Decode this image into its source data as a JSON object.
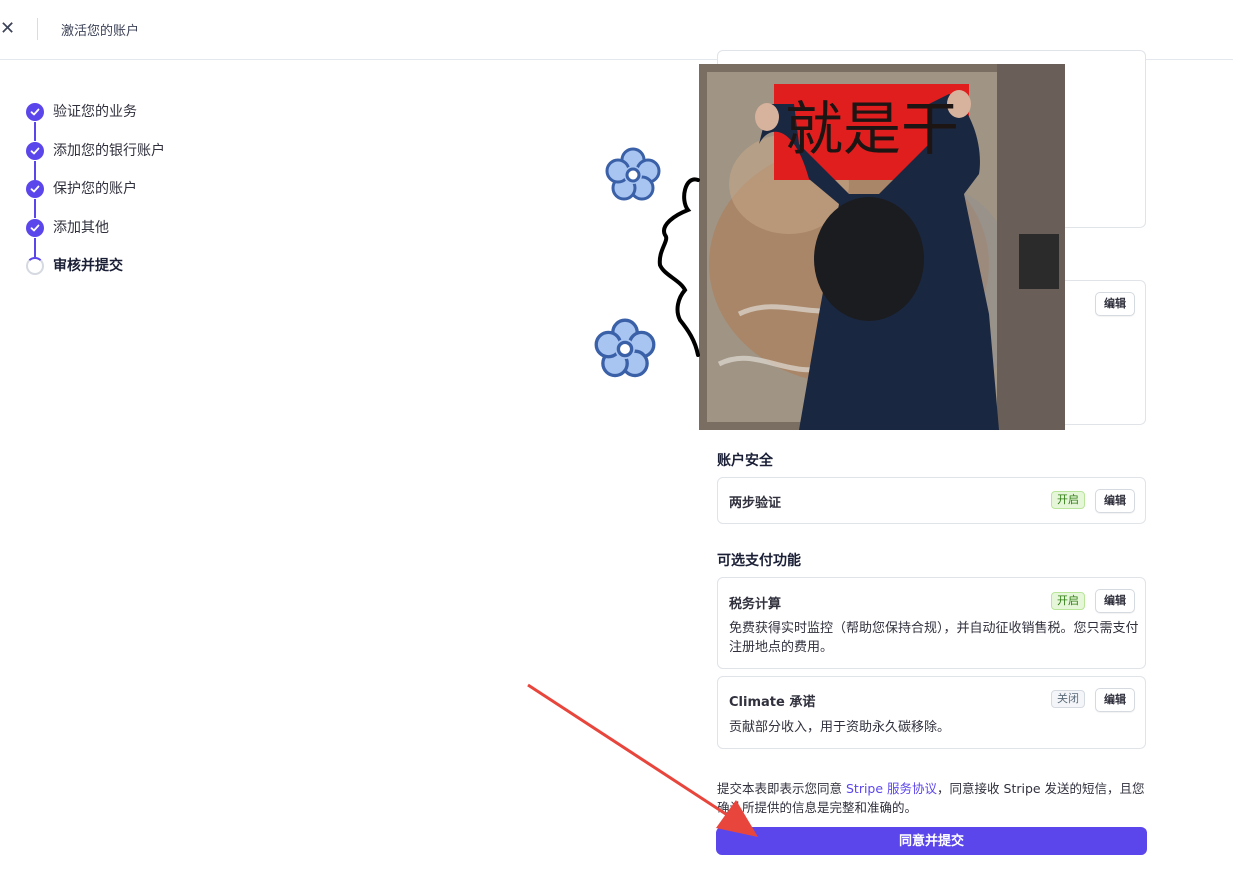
{
  "header": {
    "close_icon": "close-icon",
    "title": "激活您的账户"
  },
  "steps": [
    {
      "label": "验证您的业务",
      "status": "done"
    },
    {
      "label": "添加您的银行账户",
      "status": "done"
    },
    {
      "label": "保护您的账户",
      "status": "done"
    },
    {
      "label": "添加其他",
      "status": "done"
    },
    {
      "label": "审核并提交",
      "status": "current"
    }
  ],
  "top_card": {
    "edit_label": "编辑"
  },
  "account_security": {
    "title": "账户安全",
    "items": [
      {
        "name": "两步验证",
        "badge": "开启",
        "edit_label": "编辑"
      }
    ]
  },
  "optional_payments": {
    "title": "可选支付功能",
    "items": [
      {
        "name": "税务计算",
        "badge": "开启",
        "edit_label": "编辑",
        "desc": "免费获得实时监控（帮助您保持合规），并自动征收销售税。您只需支付注册地点的费用。"
      },
      {
        "name": "Climate 承诺",
        "badge": "关闭",
        "edit_label": "编辑",
        "desc": "贡献部分收入，用于资助永久碳移除。"
      }
    ]
  },
  "terms": {
    "prefix": "提交本表即表示您同意 ",
    "link": "Stripe 服务协议",
    "suffix": "，同意接收 Stripe 发送的短信，且您确认所提供的信息是完整和准确的。"
  },
  "submit_label": "同意并提交",
  "overlay": {
    "sign_text": "就是干",
    "flower_icon": "flower-icon",
    "arrow_icon": "red-arrow-icon"
  },
  "colors": {
    "accent": "#5b46ec",
    "on_badge": "#2f7d14",
    "arrow": "#e8463c"
  }
}
